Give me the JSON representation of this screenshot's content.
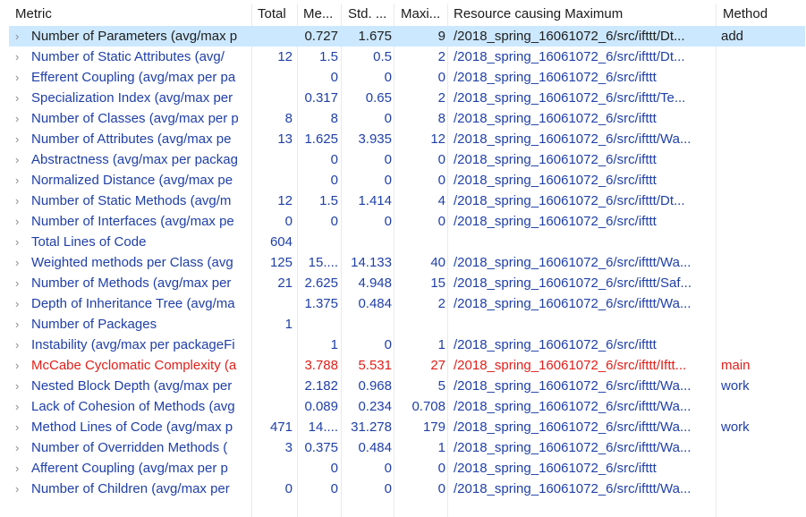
{
  "columns": {
    "metric": "Metric",
    "total": "Total",
    "mean": "Me...",
    "std": "Std. ...",
    "max": "Maxi...",
    "resource": "Resource causing Maximum",
    "method": "Method"
  },
  "colors": {
    "selected_row": "#cce8ff",
    "link_blue": "#1f3fa8",
    "alert_red": "#e0201a"
  },
  "rows": [
    {
      "metric": "Number of Parameters (avg/max p",
      "total": "",
      "mean": "0.727",
      "std": "1.675",
      "max": "9",
      "resource": "/2018_spring_16061072_6/src/ifttt/Dt...",
      "method": "add",
      "style": "dark",
      "selected": true
    },
    {
      "metric": "Number of Static Attributes (avg/",
      "total": "12",
      "mean": "1.5",
      "std": "0.5",
      "max": "2",
      "resource": "/2018_spring_16061072_6/src/ifttt/Dt...",
      "method": "",
      "style": "blue",
      "selected": false
    },
    {
      "metric": "Efferent Coupling (avg/max per pa",
      "total": "",
      "mean": "0",
      "std": "0",
      "max": "0",
      "resource": "/2018_spring_16061072_6/src/ifttt",
      "method": "",
      "style": "blue",
      "selected": false
    },
    {
      "metric": "Specialization Index (avg/max per",
      "total": "",
      "mean": "0.317",
      "std": "0.65",
      "max": "2",
      "resource": "/2018_spring_16061072_6/src/ifttt/Te...",
      "method": "",
      "style": "blue",
      "selected": false
    },
    {
      "metric": "Number of Classes (avg/max per p",
      "total": "8",
      "mean": "8",
      "std": "0",
      "max": "8",
      "resource": "/2018_spring_16061072_6/src/ifttt",
      "method": "",
      "style": "blue",
      "selected": false
    },
    {
      "metric": "Number of Attributes (avg/max pe",
      "total": "13",
      "mean": "1.625",
      "std": "3.935",
      "max": "12",
      "resource": "/2018_spring_16061072_6/src/ifttt/Wa...",
      "method": "",
      "style": "blue",
      "selected": false
    },
    {
      "metric": "Abstractness (avg/max per packag",
      "total": "",
      "mean": "0",
      "std": "0",
      "max": "0",
      "resource": "/2018_spring_16061072_6/src/ifttt",
      "method": "",
      "style": "blue",
      "selected": false
    },
    {
      "metric": "Normalized Distance (avg/max pe",
      "total": "",
      "mean": "0",
      "std": "0",
      "max": "0",
      "resource": "/2018_spring_16061072_6/src/ifttt",
      "method": "",
      "style": "blue",
      "selected": false
    },
    {
      "metric": "Number of Static Methods (avg/m",
      "total": "12",
      "mean": "1.5",
      "std": "1.414",
      "max": "4",
      "resource": "/2018_spring_16061072_6/src/ifttt/Dt...",
      "method": "",
      "style": "blue",
      "selected": false
    },
    {
      "metric": "Number of Interfaces (avg/max pe",
      "total": "0",
      "mean": "0",
      "std": "0",
      "max": "0",
      "resource": "/2018_spring_16061072_6/src/ifttt",
      "method": "",
      "style": "blue",
      "selected": false
    },
    {
      "metric": "Total Lines of Code",
      "total": "604",
      "mean": "",
      "std": "",
      "max": "",
      "resource": "",
      "method": "",
      "style": "blue",
      "selected": false
    },
    {
      "metric": "Weighted methods per Class (avg",
      "total": "125",
      "mean": "15....",
      "std": "14.133",
      "max": "40",
      "resource": "/2018_spring_16061072_6/src/ifttt/Wa...",
      "method": "",
      "style": "blue",
      "selected": false
    },
    {
      "metric": "Number of Methods (avg/max per",
      "total": "21",
      "mean": "2.625",
      "std": "4.948",
      "max": "15",
      "resource": "/2018_spring_16061072_6/src/ifttt/Saf...",
      "method": "",
      "style": "blue",
      "selected": false
    },
    {
      "metric": "Depth of Inheritance Tree (avg/ma",
      "total": "",
      "mean": "1.375",
      "std": "0.484",
      "max": "2",
      "resource": "/2018_spring_16061072_6/src/ifttt/Wa...",
      "method": "",
      "style": "blue",
      "selected": false
    },
    {
      "metric": "Number of Packages",
      "total": "1",
      "mean": "",
      "std": "",
      "max": "",
      "resource": "",
      "method": "",
      "style": "blue",
      "selected": false
    },
    {
      "metric": "Instability (avg/max per packageFi",
      "total": "",
      "mean": "1",
      "std": "0",
      "max": "1",
      "resource": "/2018_spring_16061072_6/src/ifttt",
      "method": "",
      "style": "blue",
      "selected": false
    },
    {
      "metric": "McCabe Cyclomatic Complexity (a",
      "total": "",
      "mean": "3.788",
      "std": "5.531",
      "max": "27",
      "resource": "/2018_spring_16061072_6/src/ifttt/Iftt...",
      "method": "main",
      "style": "red",
      "selected": false
    },
    {
      "metric": "Nested Block Depth (avg/max per",
      "total": "",
      "mean": "2.182",
      "std": "0.968",
      "max": "5",
      "resource": "/2018_spring_16061072_6/src/ifttt/Wa...",
      "method": "work",
      "style": "blue",
      "selected": false
    },
    {
      "metric": "Lack of Cohesion of Methods (avg",
      "total": "",
      "mean": "0.089",
      "std": "0.234",
      "max": "0.708",
      "resource": "/2018_spring_16061072_6/src/ifttt/Wa...",
      "method": "",
      "style": "blue",
      "selected": false
    },
    {
      "metric": "Method Lines of Code (avg/max p",
      "total": "471",
      "mean": "14....",
      "std": "31.278",
      "max": "179",
      "resource": "/2018_spring_16061072_6/src/ifttt/Wa...",
      "method": "work",
      "style": "blue",
      "selected": false
    },
    {
      "metric": "Number of Overridden Methods (",
      "total": "3",
      "mean": "0.375",
      "std": "0.484",
      "max": "1",
      "resource": "/2018_spring_16061072_6/src/ifttt/Wa...",
      "method": "",
      "style": "blue",
      "selected": false
    },
    {
      "metric": "Afferent Coupling (avg/max per p",
      "total": "",
      "mean": "0",
      "std": "0",
      "max": "0",
      "resource": "/2018_spring_16061072_6/src/ifttt",
      "method": "",
      "style": "blue",
      "selected": false
    },
    {
      "metric": "Number of Children (avg/max per",
      "total": "0",
      "mean": "0",
      "std": "0",
      "max": "0",
      "resource": "/2018_spring_16061072_6/src/ifttt/Wa...",
      "method": "",
      "style": "blue",
      "selected": false
    }
  ]
}
